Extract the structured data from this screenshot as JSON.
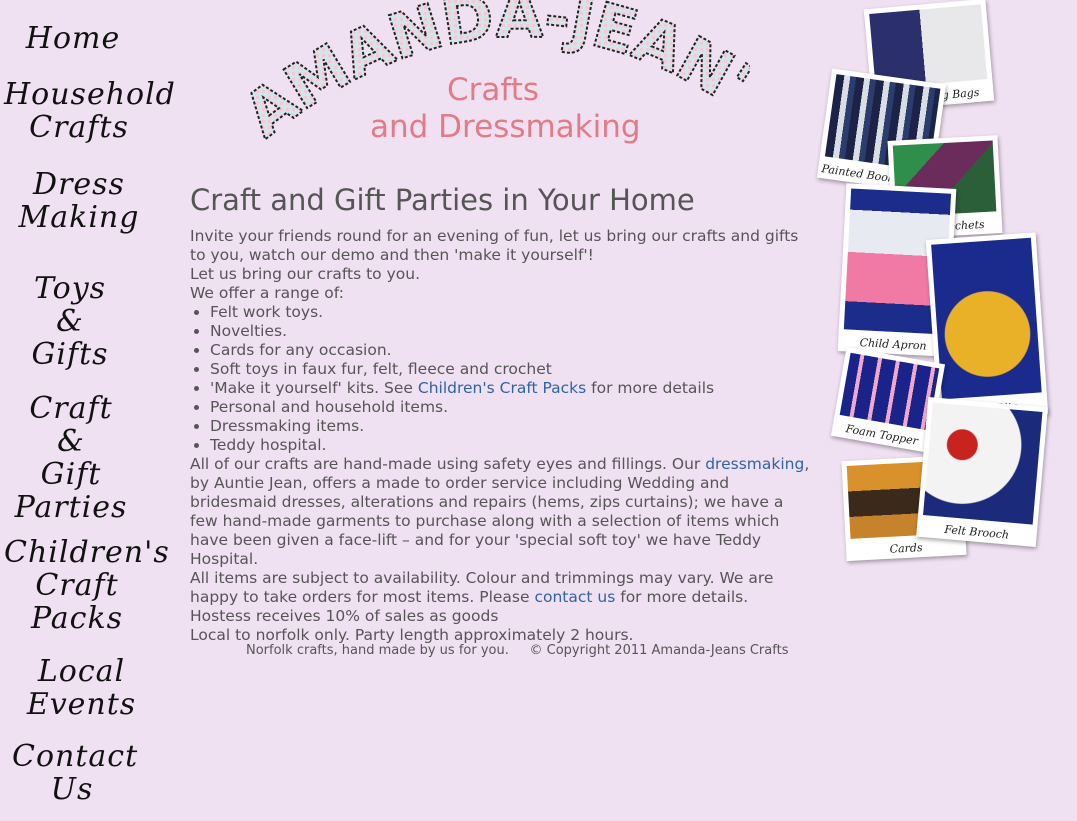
{
  "nav": {
    "home": "Home",
    "household": "Household\nCrafts",
    "dress": "Dress\nMaking",
    "toys": "Toys\n&\nGifts",
    "parties": "Craft\n&\nGift\nParties",
    "children": "Children's\nCraft\nPacks",
    "events": "Local\nEvents",
    "contact": "Contact\nUs"
  },
  "header": {
    "logo_text": "AMANDA-JEAN'S",
    "line1": "Crafts",
    "line2": "and Dressmaking"
  },
  "main": {
    "title": "Craft and Gift Parties in Your Home",
    "intro": "Invite your friends round for an evening of fun, let us bring our crafts and gifts to you, watch our demo and then 'make it yourself'!",
    "bring": "Let us bring our crafts to you.",
    "offer": "We offer a range of:",
    "items": [
      "Felt work toys.",
      "Novelties.",
      "Cards for any occasion.",
      "Soft toys in faux fur, felt, fleece and crochet",
      "Personal and household items.",
      "Dressmaking items.",
      "Teddy hospital."
    ],
    "kits_pre": "'Make it yourself' kits. See ",
    "kits_link": "Children's Craft Packs",
    "kits_post": " for more details",
    "crafts_pre": "All of our crafts are hand-made using safety eyes and fillings. Our ",
    "crafts_link": "dressmaking",
    "crafts_post": ", by Auntie Jean, offers a made to order service including Wedding and bridesmaid dresses, alterations and repairs (hems, zips curtains); we have a few hand-made garments to purchase along with a selection of items which have been given a face-lift – and for your 'special soft toy' we have Teddy Hospital.",
    "avail_pre": "All items are subject to availability. Colour and trimmings may vary. We are happy to take orders for most items. Please ",
    "avail_link": "contact us",
    "avail_post": " for more details.",
    "hostess": "Hostess receives 10% of sales as goods",
    "local": "Local to norfolk only. Party length approximately 2 hours."
  },
  "footer": {
    "text": "Norfolk crafts, hand made by us for you.     © Copyright 2011 Amanda-Jeans Crafts"
  },
  "collage": {
    "drawstring": "Drawstring Bags",
    "bookmarks": "Painted Bookmarks",
    "soap": "Soap Sachets",
    "apron": "Child Apron",
    "hairbits": "Hair Bits",
    "foam": "Foam Topper",
    "cards": "Cards",
    "brooch": "Felt Brooch"
  },
  "colors": {
    "background": "#f0e1f2",
    "accent_pink": "#e27b86",
    "link": "#2e63a8",
    "logo_fill": "#cfe7ea"
  }
}
